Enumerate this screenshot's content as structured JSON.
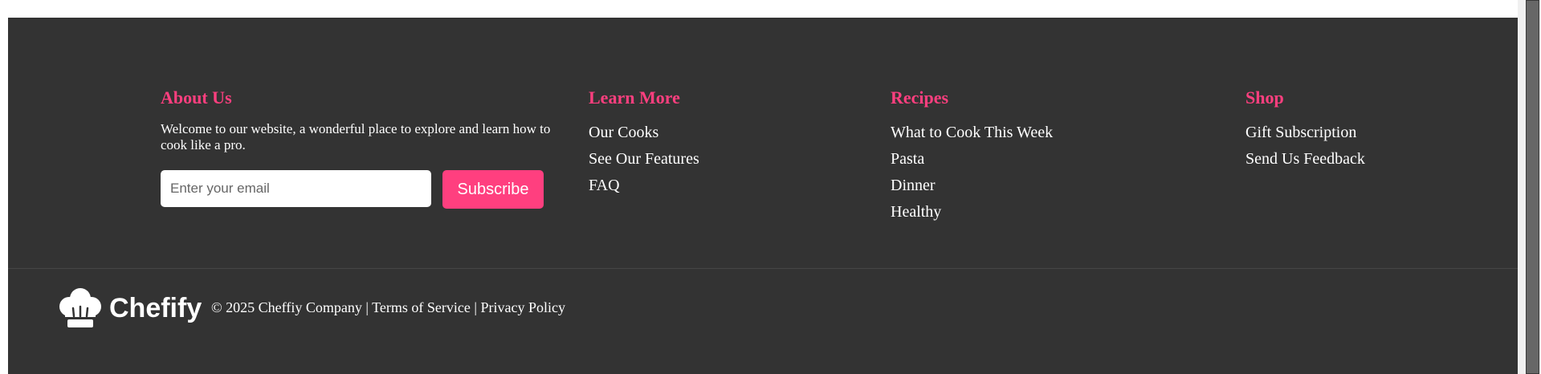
{
  "about": {
    "heading": "About Us",
    "text": "Welcome to our website, a wonderful place to explore and learn how to cook like a pro.",
    "email_placeholder": "Enter your email",
    "subscribe_label": "Subscribe"
  },
  "learn_more": {
    "heading": "Learn More",
    "links": [
      "Our Cooks",
      "See Our Features",
      "FAQ"
    ]
  },
  "recipes": {
    "heading": "Recipes",
    "links": [
      "What to Cook This Week",
      "Pasta",
      "Dinner",
      "Healthy"
    ]
  },
  "shop": {
    "heading": "Shop",
    "links": [
      "Gift Subscription",
      "Send Us Feedback"
    ]
  },
  "bottom": {
    "brand": "Chefify",
    "copyright": "© 2025 Cheffiy Company",
    "separator": "|",
    "terms": "Terms of Service",
    "privacy": "Privacy Policy"
  },
  "colors": {
    "background": "#333333",
    "accent": "#ff3f7f",
    "text": "#ffffff"
  },
  "icons": {
    "logo": "chef-hat-icon"
  }
}
